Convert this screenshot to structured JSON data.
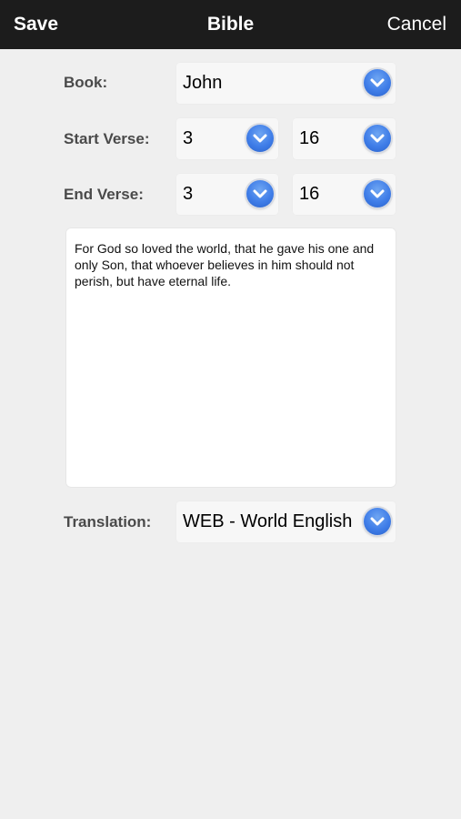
{
  "navbar": {
    "save_label": "Save",
    "title": "Bible",
    "cancel_label": "Cancel"
  },
  "form": {
    "book": {
      "label": "Book:",
      "value": "John"
    },
    "start_verse": {
      "label": "Start Verse:",
      "chapter": "3",
      "verse": "16"
    },
    "end_verse": {
      "label": "End Verse:",
      "chapter": "3",
      "verse": "16"
    },
    "passage_text": "For God so loved the world, that he gave his one and only Son, that whoever believes in him should not perish, but have eternal life.",
    "translation": {
      "label": "Translation:",
      "value": "WEB - World English"
    }
  },
  "icons": {
    "dropdown": "chevron-down-icon"
  },
  "colors": {
    "navbar_bg": "#1c1c1c",
    "dropdown_accent": "#3f7de8",
    "background": "#efefef"
  }
}
